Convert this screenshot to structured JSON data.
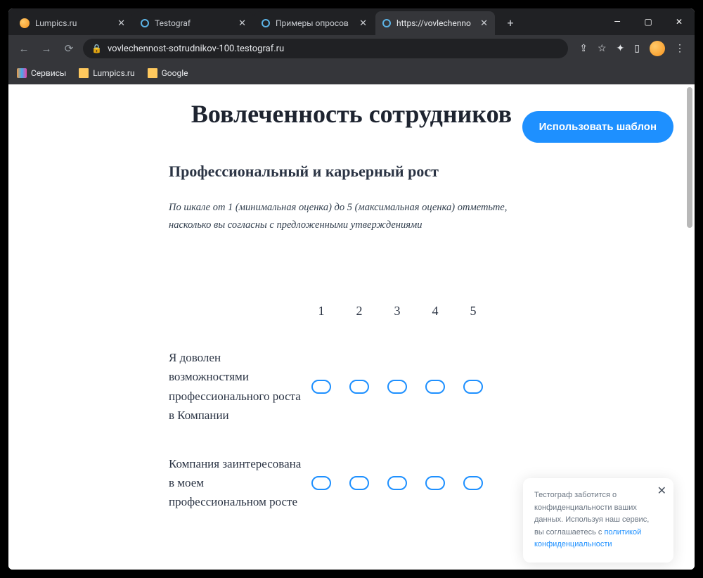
{
  "tabs": [
    {
      "label": "Lumpics.ru",
      "icon": "orange"
    },
    {
      "label": "Testograf",
      "icon": "ring"
    },
    {
      "label": "Примеры опросов",
      "icon": "ring"
    },
    {
      "label": "https://vovlechenno",
      "icon": "ring",
      "active": true
    }
  ],
  "address": "vovlechennost-sotrudnikov-100.testograf.ru",
  "bookmarks": [
    {
      "label": "Сервисы",
      "type": "grid"
    },
    {
      "label": "Lumpics.ru",
      "type": "folder"
    },
    {
      "label": "Google",
      "type": "folder"
    }
  ],
  "page": {
    "title": "Вовлеченность сотрудников",
    "use_template": "Использовать шаблон",
    "section_title": "Профессиональный и карьерный рост",
    "instruction": "По шкале от 1 (минимальная оценка) до 5 (максимальная оценка) отметьте, насколько вы согласны с предложенными утверждениями",
    "scale": [
      "1",
      "2",
      "3",
      "4",
      "5"
    ],
    "rows": [
      "Я доволен возможностями профессионального роста в Компании",
      "Компания заинтересована в моем профессиональном росте"
    ]
  },
  "cookie": {
    "text_before": "Тестограф заботится о конфиденциальности ваших данных. Используя наш сервис, вы соглашаетесь с ",
    "link": "политикой конфиденциальности"
  }
}
